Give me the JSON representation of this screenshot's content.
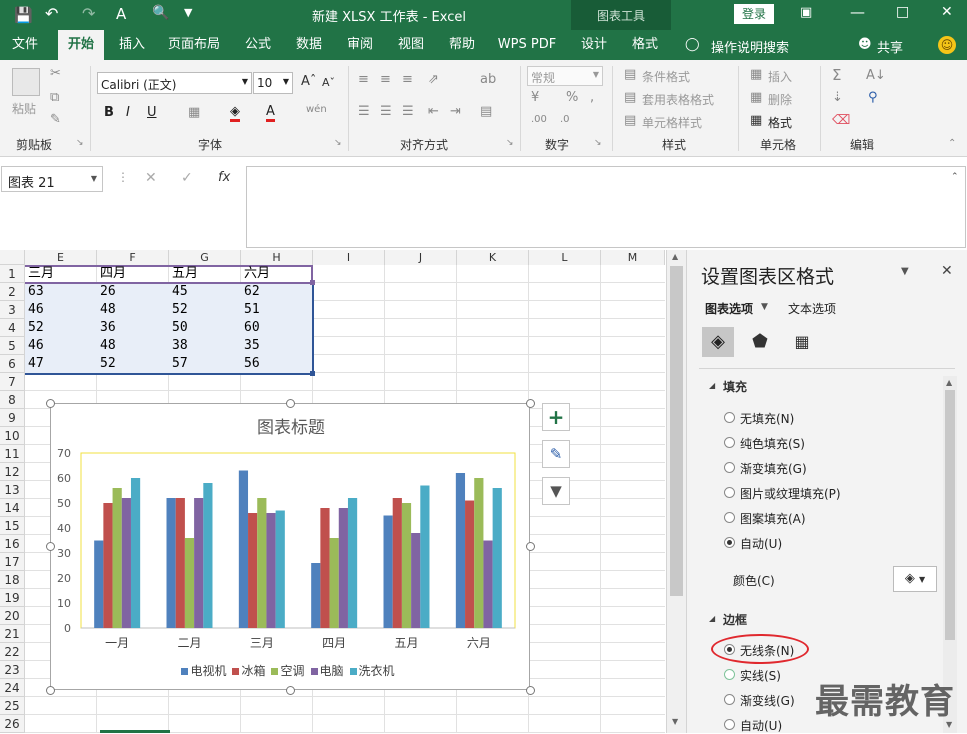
{
  "titlebar": {
    "title": "新建 XLSX 工作表 - Excel",
    "context_tool": "图表工具",
    "login": "登录"
  },
  "tabs": [
    {
      "label": "文件"
    },
    {
      "label": "开始"
    },
    {
      "label": "插入"
    },
    {
      "label": "页面布局"
    },
    {
      "label": "公式"
    },
    {
      "label": "数据"
    },
    {
      "label": "审阅"
    },
    {
      "label": "视图"
    },
    {
      "label": "帮助"
    },
    {
      "label": "WPS PDF"
    },
    {
      "label": "设计"
    },
    {
      "label": "格式"
    }
  ],
  "search_hint": "操作说明搜索",
  "share": "共享",
  "ribbon": {
    "paste": "粘贴",
    "clipboard": "剪贴板",
    "font_group": "字体",
    "align_group": "对齐方式",
    "number_group": "数字",
    "style_group": "样式",
    "cell_group": "单元格",
    "edit_group": "编辑",
    "font_name": "Calibri (正文)",
    "font_size": "10",
    "number_format": "常规",
    "cond_format": "条件格式",
    "table_format": "套用表格格式",
    "cell_style": "单元格样式",
    "insert": "插入",
    "delete": "删除",
    "format": "格式"
  },
  "namebox": "图表 21",
  "fx": "fx",
  "columns": [
    "E",
    "F",
    "G",
    "H",
    "I",
    "J",
    "K",
    "L",
    "M"
  ],
  "rows": [
    "1",
    "2",
    "3",
    "4",
    "5",
    "6",
    "7",
    "8",
    "9",
    "10",
    "11",
    "12",
    "13",
    "14",
    "15",
    "16",
    "17",
    "18",
    "19",
    "20",
    "21",
    "22",
    "23",
    "24",
    "25",
    "26"
  ],
  "table": [
    [
      "三月",
      "四月",
      "五月",
      "六月"
    ],
    [
      "63",
      "26",
      "45",
      "62"
    ],
    [
      "46",
      "48",
      "52",
      "51"
    ],
    [
      "52",
      "36",
      "50",
      "60"
    ],
    [
      "46",
      "48",
      "38",
      "35"
    ],
    [
      "47",
      "52",
      "57",
      "56"
    ]
  ],
  "chart_data": {
    "type": "bar",
    "title": "图表标题",
    "categories": [
      "一月",
      "二月",
      "三月",
      "四月",
      "五月",
      "六月"
    ],
    "ylim": [
      0,
      70
    ],
    "yticks": [
      "0",
      "10",
      "20",
      "30",
      "40",
      "50",
      "60",
      "70"
    ],
    "legend_position": "bottom",
    "grid": false,
    "series": [
      {
        "name": "电视机",
        "color": "#4f81bd",
        "values": [
          35,
          52,
          63,
          26,
          45,
          62
        ]
      },
      {
        "name": "冰箱",
        "color": "#c0504d",
        "values": [
          50,
          52,
          46,
          48,
          52,
          51
        ]
      },
      {
        "name": "空调",
        "color": "#9bbb59",
        "values": [
          56,
          36,
          52,
          36,
          50,
          60
        ]
      },
      {
        "name": "电脑",
        "color": "#8064a2",
        "values": [
          52,
          52,
          46,
          48,
          38,
          35
        ]
      },
      {
        "name": "洗衣机",
        "color": "#4bacc6",
        "values": [
          60,
          58,
          47,
          52,
          57,
          56
        ]
      }
    ]
  },
  "pane": {
    "title": "设置图表区格式",
    "tab_chart": "图表选项",
    "tab_text": "文本选项",
    "fill_section": "填充",
    "fill_options": [
      "无填充(N)",
      "纯色填充(S)",
      "渐变填充(G)",
      "图片或纹理填充(P)",
      "图案填充(A)",
      "自动(U)"
    ],
    "color_label": "颜色(C)",
    "border_section": "边框",
    "border_options": [
      "无线条(N)",
      "实线(S)",
      "渐变线(G)",
      "自动(U)"
    ]
  },
  "watermark": "最需教育",
  "colors": {
    "excel_green": "#217346",
    "highlight_red": "#e0282e"
  }
}
